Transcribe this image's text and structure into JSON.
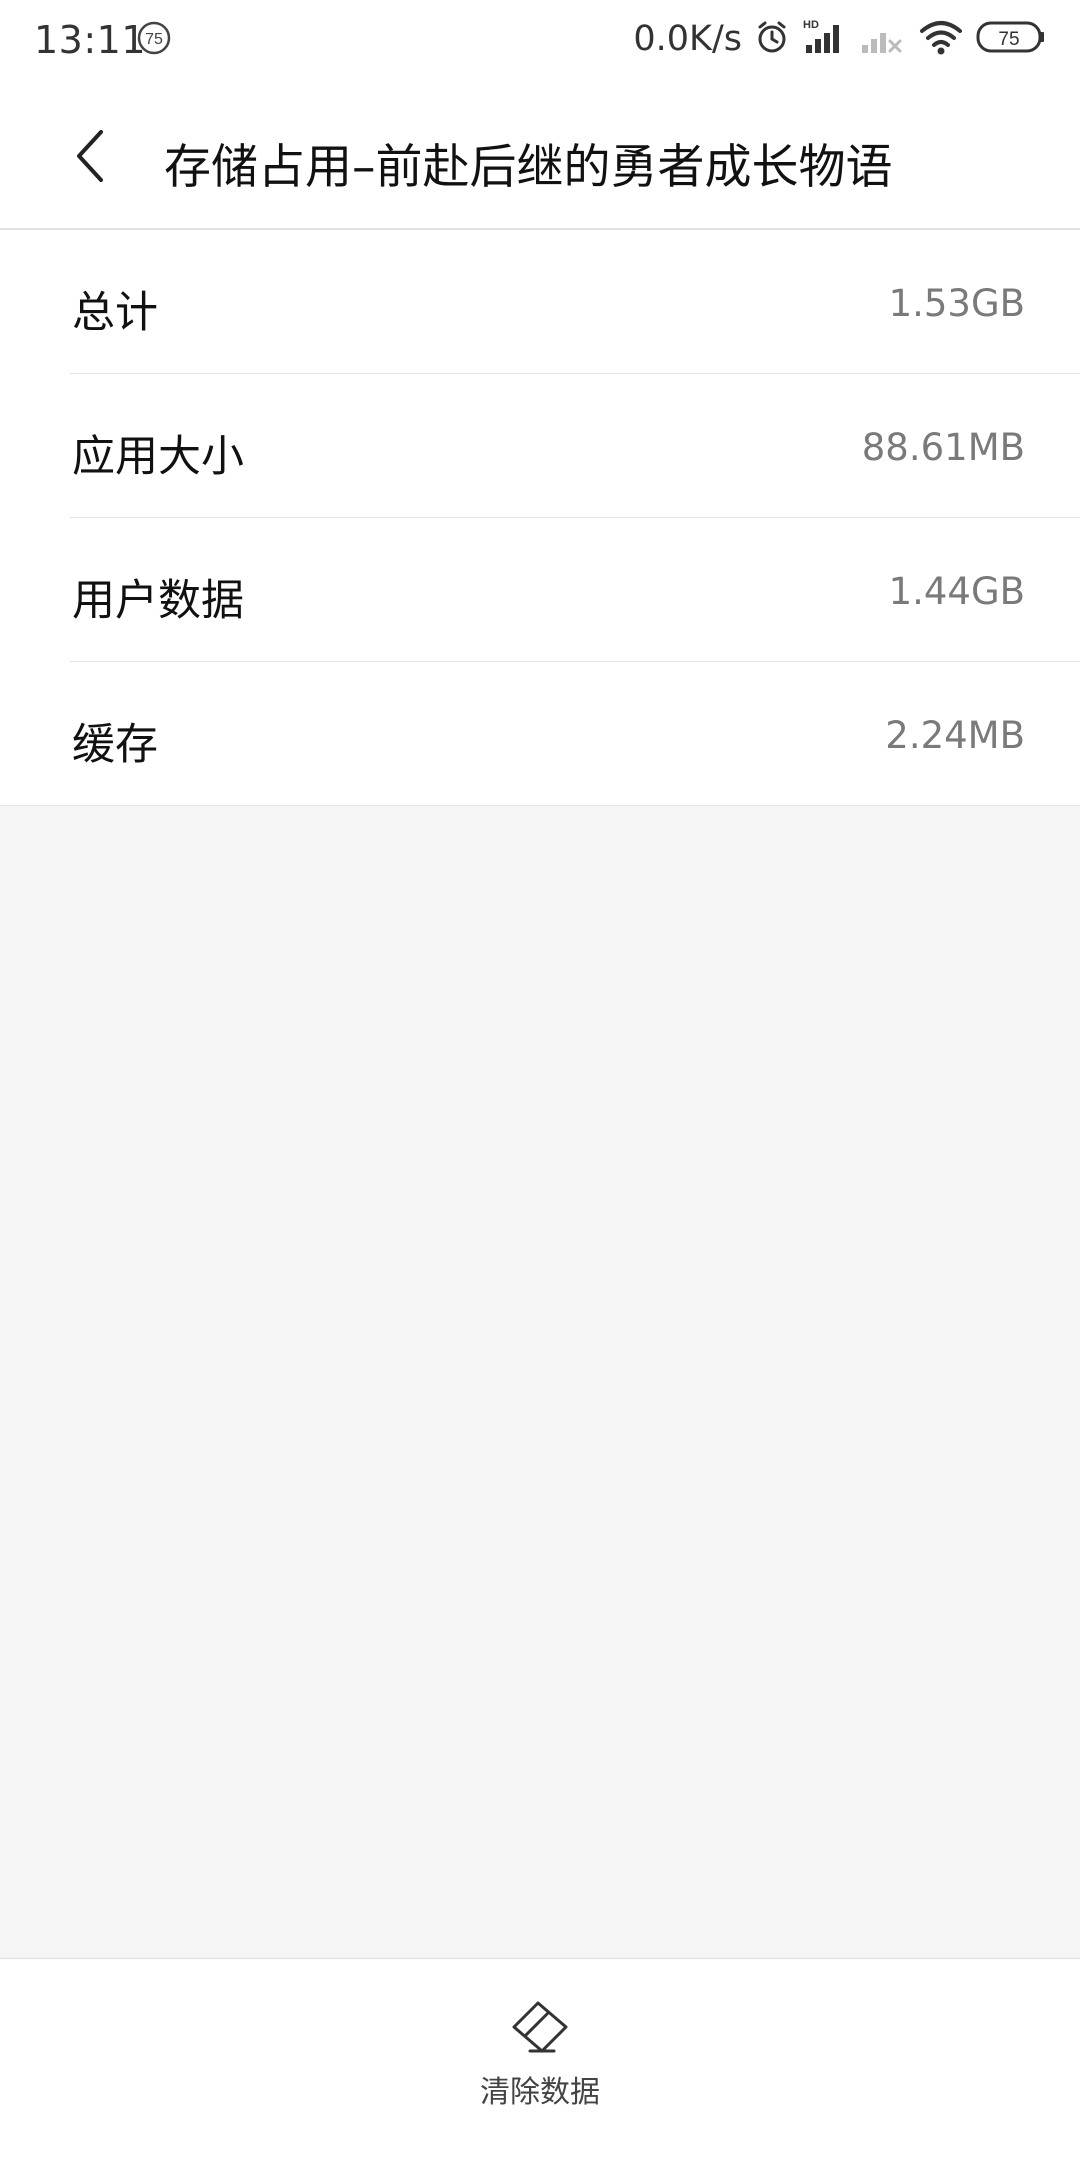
{
  "status_bar": {
    "time": "13:11",
    "notification_badge": "75",
    "net_speed": "0.0K/s",
    "signal_hd_label": "HD",
    "battery_level": "75",
    "icons": [
      "alarm-icon",
      "signal-hd-icon",
      "signal-no-service-icon",
      "wifi-icon",
      "battery-icon"
    ]
  },
  "header": {
    "back_icon": "chevron-left-icon",
    "title": "存储占用–前赴后继的勇者成长物语"
  },
  "storage": {
    "rows": [
      {
        "label": "总计",
        "value": "1.53GB"
      },
      {
        "label": "应用大小",
        "value": "88.61MB"
      },
      {
        "label": "用户数据",
        "value": "1.44GB"
      },
      {
        "label": "缓存",
        "value": "2.24MB"
      }
    ]
  },
  "bottom_bar": {
    "clear_icon": "eraser-icon",
    "clear_label": "清除数据"
  }
}
